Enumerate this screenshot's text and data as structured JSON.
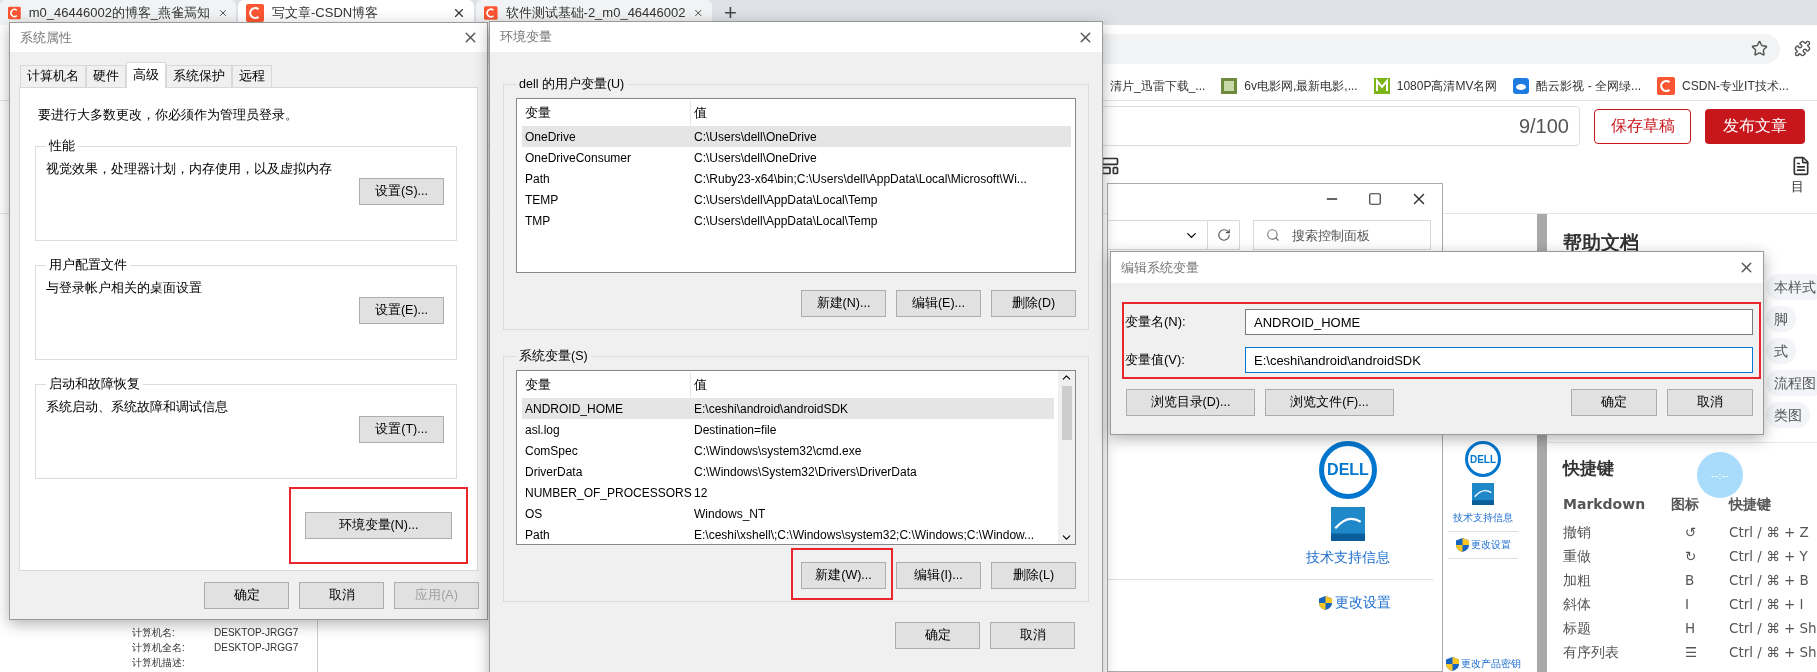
{
  "browser": {
    "tabs": [
      {
        "title": "m0_46446002的博客_燕雀焉知",
        "selected": false
      },
      {
        "title": "写文章-CSDN博客",
        "selected": true
      },
      {
        "title": "软件测试基础-2_m0_46446002",
        "selected": false
      }
    ],
    "new_tab": "+",
    "bookmarks": [
      {
        "label": "清片_迅雷下载_...",
        "kind": "none"
      },
      {
        "label": "6v电影网,最新电影,...",
        "kind": "film"
      },
      {
        "label": "1080P高清MV名网",
        "kind": "mv"
      },
      {
        "label": "酷云影视 - 全网绿...",
        "kind": "cloud"
      },
      {
        "label": "CSDN-专业IT技术...",
        "kind": "csdn"
      }
    ]
  },
  "editor": {
    "title_count": "9/100",
    "save_button": "保存草稿",
    "publish_button": "发布文章",
    "toc_label": "目"
  },
  "preview_image": {
    "logo_text": "DELL",
    "links": [
      "技术支持信息",
      "更改设置",
      "更改产品密钥"
    ]
  },
  "help_panel": {
    "title": "帮助文档",
    "chips": [
      [
        "本样式"
      ],
      [
        "脚"
      ],
      [
        "式"
      ],
      [
        "流程图"
      ],
      [
        "类图"
      ]
    ],
    "shortcuts_title": "快捷键",
    "columns": [
      "Markdown",
      "图标",
      "快捷键"
    ],
    "rows": [
      {
        "action": "撤销",
        "icon": "↺",
        "keys": "Ctrl / ⌘ + Z"
      },
      {
        "action": "重做",
        "icon": "↻",
        "keys": "Ctrl / ⌘ + Y"
      },
      {
        "action": "加粗",
        "icon": "B",
        "keys": "Ctrl / ⌘ + B"
      },
      {
        "action": "斜体",
        "icon": "I",
        "keys": "Ctrl / ⌘ + I"
      },
      {
        "action": "标题",
        "icon": "H",
        "keys": "Ctrl / ⌘ + Sh"
      },
      {
        "action": "有序列表",
        "icon": "☰",
        "keys": "Ctrl / ⌘ + Sh"
      }
    ],
    "timer": "--:--"
  },
  "background_window": {
    "rows": [
      {
        "label": "计算机名:",
        "value": "DESKTOP-JRGG7"
      },
      {
        "label": "计算机全名:",
        "value": "DESKTOP-JRGG7"
      },
      {
        "label": "计算机描述:"
      }
    ]
  },
  "control_panel": {
    "search_placeholder": "搜索控制面板",
    "logo_text": "DELL",
    "support_link": "技术支持信息",
    "settings_link": "更改设置"
  },
  "system_properties": {
    "title": "系统属性",
    "tabs": [
      {
        "label": "计算机名",
        "selected": false
      },
      {
        "label": "硬件",
        "selected": false
      },
      {
        "label": "高级",
        "selected": true
      },
      {
        "label": "系统保护",
        "selected": false
      },
      {
        "label": "远程",
        "selected": false
      }
    ],
    "notice": "要进行大多数更改，你必须作为管理员登录。",
    "groups": [
      {
        "title": "性能",
        "text": "视觉效果，处理器计划，内存使用，以及虚拟内存",
        "button": "设置(S)..."
      },
      {
        "title": "用户配置文件",
        "text": "与登录帐户相关的桌面设置",
        "button": "设置(E)..."
      },
      {
        "title": "启动和故障恢复",
        "text": "系统启动、系统故障和调试信息",
        "button": "设置(T)..."
      }
    ],
    "env_button": {
      "label": "环境变量(N)...",
      "highlighted": true
    },
    "footer_buttons": [
      {
        "label": "确定",
        "disabled": false
      },
      {
        "label": "取消",
        "disabled": false
      },
      {
        "label": "应用(A)",
        "disabled": true
      }
    ]
  },
  "env_vars": {
    "title": "环境变量",
    "user_vars": {
      "title": "dell 的用户变量(U)",
      "columns": [
        "变量",
        "值"
      ],
      "rows": [
        {
          "name": "OneDrive",
          "value": "C:\\Users\\dell\\OneDrive",
          "selected": true
        },
        {
          "name": "OneDriveConsumer",
          "value": "C:\\Users\\dell\\OneDrive",
          "selected": false
        },
        {
          "name": "Path",
          "value": "C:\\Ruby23-x64\\bin;C:\\Users\\dell\\AppData\\Local\\Microsoft\\Wi...",
          "selected": false
        },
        {
          "name": "TEMP",
          "value": "C:\\Users\\dell\\AppData\\Local\\Temp",
          "selected": false
        },
        {
          "name": "TMP",
          "value": "C:\\Users\\dell\\AppData\\Local\\Temp",
          "selected": false
        }
      ],
      "buttons": [
        {
          "label": "新建(N)...",
          "highlighted": false
        },
        {
          "label": "编辑(E)...",
          "highlighted": false
        },
        {
          "label": "删除(D)",
          "highlighted": false
        }
      ]
    },
    "system_vars": {
      "title": "系统变量(S)",
      "columns": [
        "变量",
        "值"
      ],
      "rows": [
        {
          "name": "ANDROID_HOME",
          "value": "E:\\ceshi\\android\\androidSDK",
          "selected": true
        },
        {
          "name": "asl.log",
          "value": "Destination=file",
          "selected": false
        },
        {
          "name": "ComSpec",
          "value": "C:\\Windows\\system32\\cmd.exe",
          "selected": false
        },
        {
          "name": "DriverData",
          "value": "C:\\Windows\\System32\\Drivers\\DriverData",
          "selected": false
        },
        {
          "name": "NUMBER_OF_PROCESSORS",
          "value": "12",
          "selected": false
        },
        {
          "name": "OS",
          "value": "Windows_NT",
          "selected": false
        },
        {
          "name": "Path",
          "value": "E:\\ceshi\\xshell\\;C:\\Windows\\system32;C:\\Windows;C:\\Window...",
          "selected": false
        }
      ],
      "buttons": [
        {
          "label": "新建(W)...",
          "highlighted": true
        },
        {
          "label": "编辑(I)...",
          "highlighted": false
        },
        {
          "label": "删除(L)",
          "highlighted": false
        }
      ]
    },
    "footer_buttons": [
      "确定",
      "取消"
    ]
  },
  "edit_dialog": {
    "title": "编辑系统变量",
    "fields_highlighted": true,
    "fields": [
      {
        "label": "变量名(N):",
        "value": "ANDROID_HOME",
        "focused": false
      },
      {
        "label": "变量值(V):",
        "value": "E:\\ceshi\\android\\androidSDK",
        "focused": true
      }
    ],
    "left_buttons": [
      "浏览目录(D)...",
      "浏览文件(F)..."
    ],
    "right_buttons": [
      "确定",
      "取消"
    ]
  }
}
